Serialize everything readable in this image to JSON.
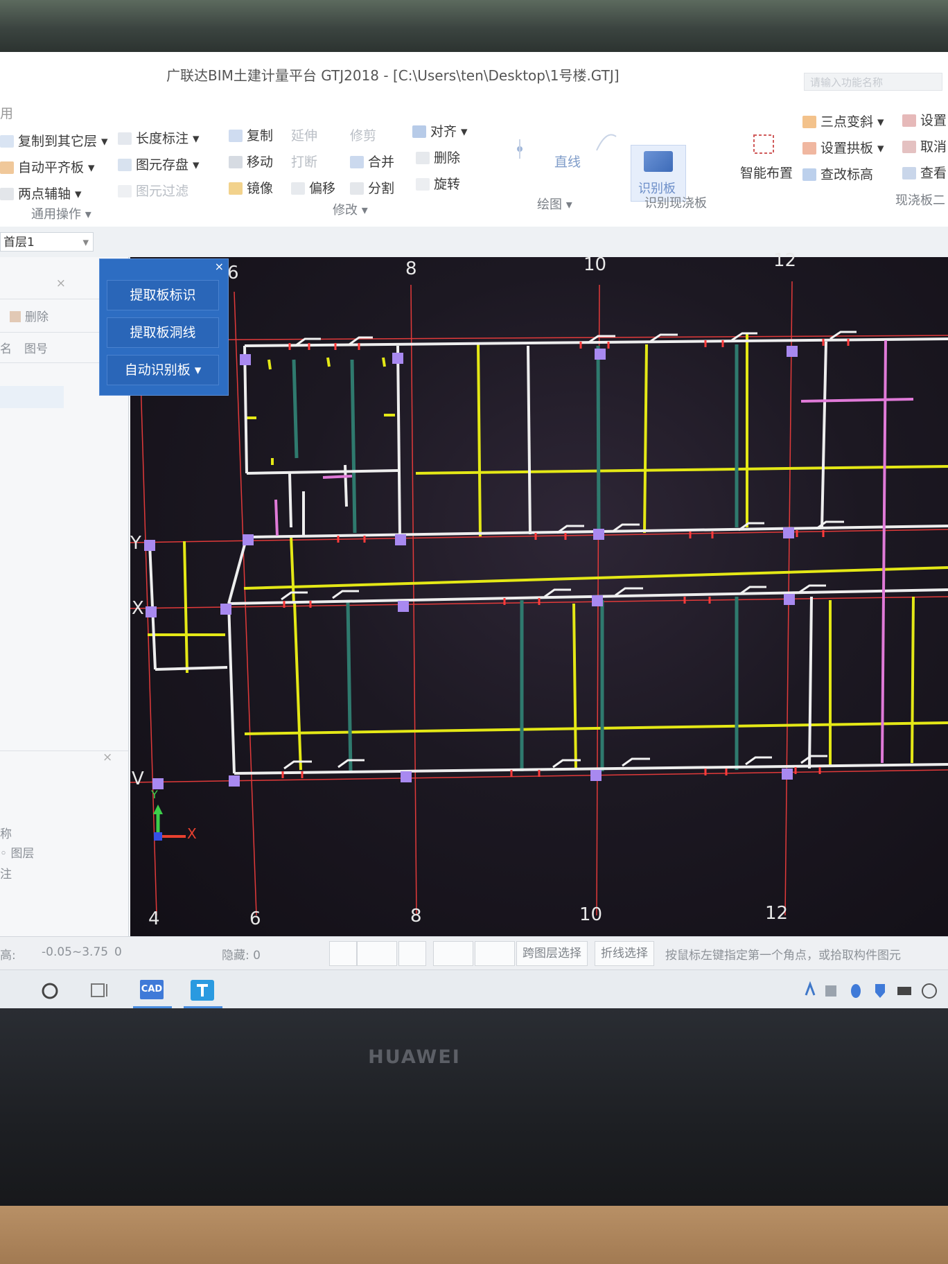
{
  "app": {
    "title": "广联达BIM土建计量平台 GTJ2018 - [C:\\Users\\ten\\Desktop\\1号楼.GTJ]",
    "search_placeholder": "请输入功能名称"
  },
  "ribbon": {
    "col1": [
      "复制到其它层",
      "自动平齐板",
      "两点辅轴"
    ],
    "col2": [
      "长度标注",
      "图元存盘",
      "图元过滤"
    ],
    "col3": [
      "复制",
      "移动",
      "镜像"
    ],
    "col4_dim": [
      "延伸",
      "打断"
    ],
    "col4": [
      "偏移"
    ],
    "col5_dim": [
      "修剪"
    ],
    "col5": [
      "合并",
      "分割"
    ],
    "col6": [
      "对齐",
      "删除",
      "旋转"
    ],
    "draw_line": "直线",
    "recognize_slab": "识别板",
    "smart_layout": "智能布置",
    "col_right1": [
      "三点变斜",
      "设置拱板",
      "查改标高"
    ],
    "col_right2": [
      "设置",
      "取消",
      "查看"
    ],
    "group_labels": {
      "common": "通用操作",
      "modify": "修改",
      "draw": "绘图",
      "recognize": "识别现浇板",
      "slab": "现浇板二"
    }
  },
  "floor_select": "首层1",
  "left_panel": {
    "delete": "删除",
    "col_header_a": "名",
    "col_header_b": "图号",
    "prop_a": "称",
    "prop_b": "图层",
    "prop_c": "注"
  },
  "float_panel": {
    "btn1": "提取板标识",
    "btn2": "提取板洞线",
    "btn3": "自动识别板"
  },
  "axes": {
    "top": [
      "6",
      "8",
      "10",
      "12"
    ],
    "bottom": [
      "4",
      "6",
      "8",
      "10",
      "12"
    ],
    "left": [
      "Y",
      "X",
      "V"
    ],
    "ucs_x": "X",
    "ucs_y": "Y"
  },
  "status": {
    "elevation": "-0.05~3.75",
    "zero": "0",
    "hidden": "隐藏: 0",
    "cross_layer": "跨图层选择",
    "polyline_select": "折线选择",
    "hint": "按鼠标左键指定第一个角点，或拾取构件图元"
  },
  "taskbar": {
    "cad_label": "CAD"
  },
  "brand": "HUAWEI"
}
